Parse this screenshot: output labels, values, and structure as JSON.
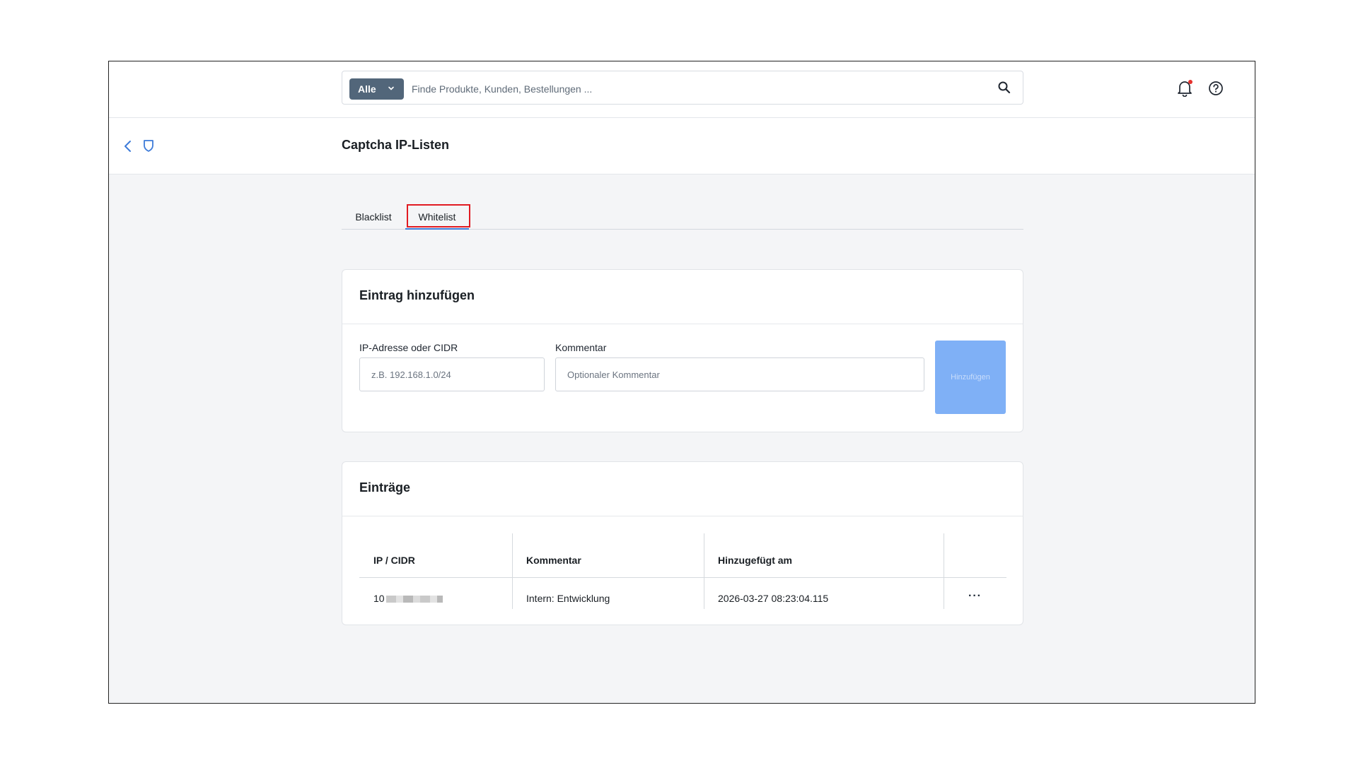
{
  "search": {
    "scope_label": "Alle",
    "placeholder": "Finde Produkte, Kunden, Bestellungen ..."
  },
  "header": {
    "title": "Captcha IP-Listen"
  },
  "tabs": [
    {
      "label": "Blacklist",
      "active": false
    },
    {
      "label": "Whitelist",
      "active": true
    }
  ],
  "add_entry": {
    "title": "Eintrag hinzufügen",
    "ip_label": "IP-Adresse oder CIDR",
    "ip_placeholder": "z.B. 192.168.1.0/24",
    "comment_label": "Kommentar",
    "comment_placeholder": "Optionaler Kommentar",
    "button_label": "Hinzufügen"
  },
  "entries": {
    "title": "Einträge",
    "columns": [
      "IP / CIDR",
      "Kommentar",
      "Hinzugefügt am"
    ],
    "rows": [
      {
        "ip": "10",
        "comment": "Intern: Entwicklung",
        "added": "2026-03-27 08:23:04.115",
        "menu": "···"
      }
    ]
  },
  "colors": {
    "accent": "#3d7bd9",
    "scope_button": "#52667a",
    "add_button": "#7fb0f6",
    "notification_dot": "#e5322d",
    "highlight": "#e11b22"
  }
}
